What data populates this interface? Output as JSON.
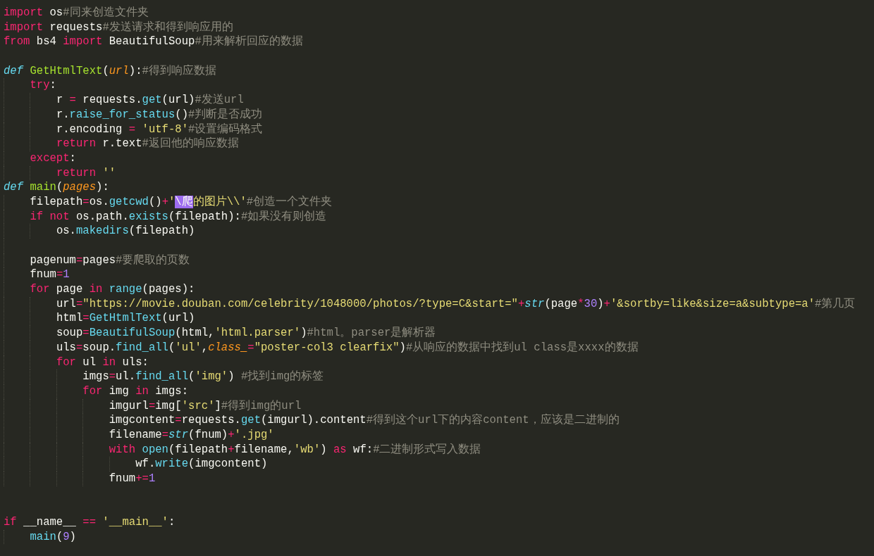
{
  "editor": {
    "lines": [
      {
        "kind": "code",
        "tokens": [
          {
            "kind": "k",
            "text": "import"
          },
          {
            "kind": "x",
            "text": " os"
          },
          {
            "kind": "m",
            "text": "#同来创造文件夹"
          }
        ]
      },
      {
        "kind": "code",
        "tokens": [
          {
            "kind": "k",
            "text": "import"
          },
          {
            "kind": "x",
            "text": " requests"
          },
          {
            "kind": "m",
            "text": "#发送请求和得到响应用的"
          }
        ]
      },
      {
        "kind": "code",
        "tokens": [
          {
            "kind": "k",
            "text": "from"
          },
          {
            "kind": "x",
            "text": " bs4 "
          },
          {
            "kind": "k",
            "text": "import"
          },
          {
            "kind": "x",
            "text": " BeautifulSoup"
          },
          {
            "kind": "m",
            "text": "#用来解析回应的数据"
          }
        ]
      },
      {
        "kind": "blank"
      },
      {
        "kind": "code",
        "tokens": [
          {
            "kind": "t",
            "text": "def"
          },
          {
            "kind": "f",
            "text": " GetHtmlText"
          },
          {
            "kind": "x",
            "text": "("
          },
          {
            "kind": "p",
            "text": "url"
          },
          {
            "kind": "x",
            "text": "):"
          },
          {
            "kind": "m",
            "text": "#得到响应数据"
          }
        ],
        "children": [
          {
            "kind": "code",
            "tokens": [
              {
                "kind": "k",
                "text": "try"
              },
              {
                "kind": "x",
                "text": ":"
              }
            ],
            "children": [
              {
                "kind": "code",
                "tokens": [
                  {
                    "kind": "x",
                    "text": "r "
                  },
                  {
                    "kind": "o",
                    "text": "="
                  },
                  {
                    "kind": "x",
                    "text": " requests."
                  },
                  {
                    "kind": "c",
                    "text": "get"
                  },
                  {
                    "kind": "x",
                    "text": "(url)"
                  },
                  {
                    "kind": "m",
                    "text": "#发送url"
                  }
                ]
              },
              {
                "kind": "code",
                "tokens": [
                  {
                    "kind": "x",
                    "text": "r."
                  },
                  {
                    "kind": "c",
                    "text": "raise_for_status"
                  },
                  {
                    "kind": "x",
                    "text": "()"
                  },
                  {
                    "kind": "m",
                    "text": "#判断是否成功"
                  }
                ]
              },
              {
                "kind": "code",
                "tokens": [
                  {
                    "kind": "x",
                    "text": "r.encoding "
                  },
                  {
                    "kind": "o",
                    "text": "="
                  },
                  {
                    "kind": "s",
                    "text": " 'utf-8'"
                  },
                  {
                    "kind": "m",
                    "text": "#设置编码格式"
                  }
                ]
              },
              {
                "kind": "code",
                "tokens": [
                  {
                    "kind": "k",
                    "text": "return"
                  },
                  {
                    "kind": "x",
                    "text": " r.text"
                  },
                  {
                    "kind": "m",
                    "text": "#返回他的响应数据"
                  }
                ]
              }
            ]
          },
          {
            "kind": "code",
            "tokens": [
              {
                "kind": "k",
                "text": "except"
              },
              {
                "kind": "x",
                "text": ":"
              }
            ],
            "children": [
              {
                "kind": "code",
                "tokens": [
                  {
                    "kind": "k",
                    "text": "return"
                  },
                  {
                    "kind": "s",
                    "text": " ''"
                  }
                ]
              }
            ]
          }
        ]
      },
      {
        "kind": "code",
        "tokens": [
          {
            "kind": "t",
            "text": "def"
          },
          {
            "kind": "f",
            "text": " main"
          },
          {
            "kind": "x",
            "text": "("
          },
          {
            "kind": "p",
            "text": "pages"
          },
          {
            "kind": "x",
            "text": "):"
          }
        ],
        "children": [
          {
            "kind": "code",
            "tokens": [
              {
                "kind": "x",
                "text": "filepath"
              },
              {
                "kind": "o",
                "text": "="
              },
              {
                "kind": "x",
                "text": "os."
              },
              {
                "kind": "c",
                "text": "getcwd"
              },
              {
                "kind": "x",
                "text": "()"
              },
              {
                "kind": "o",
                "text": "+"
              },
              {
                "kind": "s",
                "text": "'"
              },
              {
                "kind": "sel",
                "text": "\\爬"
              },
              {
                "kind": "s",
                "text": "的图片\\\\'"
              },
              {
                "kind": "m",
                "text": "#创造一个文件夹"
              }
            ]
          },
          {
            "kind": "code",
            "tokens": [
              {
                "kind": "k",
                "text": "if"
              },
              {
                "kind": "k",
                "text": " not"
              },
              {
                "kind": "x",
                "text": " os.path."
              },
              {
                "kind": "c",
                "text": "exists"
              },
              {
                "kind": "x",
                "text": "(filepath):"
              },
              {
                "kind": "m",
                "text": "#如果没有则创造"
              }
            ],
            "children": [
              {
                "kind": "code",
                "tokens": [
                  {
                    "kind": "x",
                    "text": "os."
                  },
                  {
                    "kind": "c",
                    "text": "makedirs"
                  },
                  {
                    "kind": "x",
                    "text": "(filepath)"
                  }
                ]
              }
            ]
          },
          {
            "kind": "blank"
          },
          {
            "kind": "code",
            "tokens": [
              {
                "kind": "x",
                "text": "pagenum"
              },
              {
                "kind": "o",
                "text": "="
              },
              {
                "kind": "x",
                "text": "pages"
              },
              {
                "kind": "m",
                "text": "#要爬取的页数"
              }
            ]
          },
          {
            "kind": "code",
            "tokens": [
              {
                "kind": "x",
                "text": "fnum"
              },
              {
                "kind": "o",
                "text": "="
              },
              {
                "kind": "n",
                "text": "1"
              }
            ]
          },
          {
            "kind": "code",
            "tokens": [
              {
                "kind": "k",
                "text": "for"
              },
              {
                "kind": "x",
                "text": " page "
              },
              {
                "kind": "k",
                "text": "in"
              },
              {
                "kind": "c",
                "text": " range"
              },
              {
                "kind": "x",
                "text": "(pages):"
              }
            ],
            "children": [
              {
                "kind": "code",
                "tokens": [
                  {
                    "kind": "x",
                    "text": "url"
                  },
                  {
                    "kind": "o",
                    "text": "="
                  },
                  {
                    "kind": "s",
                    "text": "\"https://movie.douban.com/celebrity/1048000/photos/?type=C&start=\""
                  },
                  {
                    "kind": "o",
                    "text": "+"
                  },
                  {
                    "kind": "t",
                    "text": "str"
                  },
                  {
                    "kind": "x",
                    "text": "(page"
                  },
                  {
                    "kind": "o",
                    "text": "*"
                  },
                  {
                    "kind": "n",
                    "text": "30"
                  },
                  {
                    "kind": "x",
                    "text": ")"
                  },
                  {
                    "kind": "o",
                    "text": "+"
                  },
                  {
                    "kind": "s",
                    "text": "'&sortby=like&size=a&subtype=a'"
                  },
                  {
                    "kind": "m",
                    "text": "#第几页"
                  }
                ]
              },
              {
                "kind": "code",
                "tokens": [
                  {
                    "kind": "x",
                    "text": "html"
                  },
                  {
                    "kind": "o",
                    "text": "="
                  },
                  {
                    "kind": "c",
                    "text": "GetHtmlText"
                  },
                  {
                    "kind": "x",
                    "text": "(url)"
                  }
                ]
              },
              {
                "kind": "code",
                "tokens": [
                  {
                    "kind": "x",
                    "text": "soup"
                  },
                  {
                    "kind": "o",
                    "text": "="
                  },
                  {
                    "kind": "c",
                    "text": "BeautifulSoup"
                  },
                  {
                    "kind": "x",
                    "text": "(html,"
                  },
                  {
                    "kind": "s",
                    "text": "'html.parser'"
                  },
                  {
                    "kind": "x",
                    "text": ")"
                  },
                  {
                    "kind": "m",
                    "text": "#html。parser是解析器"
                  }
                ]
              },
              {
                "kind": "code",
                "tokens": [
                  {
                    "kind": "x",
                    "text": "uls"
                  },
                  {
                    "kind": "o",
                    "text": "="
                  },
                  {
                    "kind": "x",
                    "text": "soup."
                  },
                  {
                    "kind": "c",
                    "text": "find_all"
                  },
                  {
                    "kind": "x",
                    "text": "("
                  },
                  {
                    "kind": "s",
                    "text": "'ul'"
                  },
                  {
                    "kind": "x",
                    "text": ","
                  },
                  {
                    "kind": "p",
                    "text": "class_"
                  },
                  {
                    "kind": "o",
                    "text": "="
                  },
                  {
                    "kind": "s",
                    "text": "\"poster-col3 clearfix\""
                  },
                  {
                    "kind": "x",
                    "text": ")"
                  },
                  {
                    "kind": "m",
                    "text": "#从响应的数据中找到ul class是xxxx的数据"
                  }
                ]
              },
              {
                "kind": "code",
                "tokens": [
                  {
                    "kind": "k",
                    "text": "for"
                  },
                  {
                    "kind": "x",
                    "text": " ul "
                  },
                  {
                    "kind": "k",
                    "text": "in"
                  },
                  {
                    "kind": "x",
                    "text": " uls:"
                  }
                ],
                "children": [
                  {
                    "kind": "code",
                    "tokens": [
                      {
                        "kind": "x",
                        "text": "imgs"
                      },
                      {
                        "kind": "o",
                        "text": "="
                      },
                      {
                        "kind": "x",
                        "text": "ul."
                      },
                      {
                        "kind": "c",
                        "text": "find_all"
                      },
                      {
                        "kind": "x",
                        "text": "("
                      },
                      {
                        "kind": "s",
                        "text": "'img'"
                      },
                      {
                        "kind": "x",
                        "text": ")"
                      },
                      {
                        "kind": "m",
                        "text": " #找到img的标签"
                      }
                    ]
                  },
                  {
                    "kind": "code",
                    "tokens": [
                      {
                        "kind": "k",
                        "text": "for"
                      },
                      {
                        "kind": "x",
                        "text": " img "
                      },
                      {
                        "kind": "k",
                        "text": "in"
                      },
                      {
                        "kind": "x",
                        "text": " imgs:"
                      }
                    ],
                    "children": [
                      {
                        "kind": "code",
                        "tokens": [
                          {
                            "kind": "x",
                            "text": "imgurl"
                          },
                          {
                            "kind": "o",
                            "text": "="
                          },
                          {
                            "kind": "x",
                            "text": "img["
                          },
                          {
                            "kind": "s",
                            "text": "'src'"
                          },
                          {
                            "kind": "x",
                            "text": "]"
                          },
                          {
                            "kind": "m",
                            "text": "#得到img的url"
                          }
                        ]
                      },
                      {
                        "kind": "code",
                        "tokens": [
                          {
                            "kind": "x",
                            "text": "imgcontent"
                          },
                          {
                            "kind": "o",
                            "text": "="
                          },
                          {
                            "kind": "x",
                            "text": "requests."
                          },
                          {
                            "kind": "c",
                            "text": "get"
                          },
                          {
                            "kind": "x",
                            "text": "(imgurl).content"
                          },
                          {
                            "kind": "m",
                            "text": "#得到这个url下的内容content，应该是二进制的"
                          }
                        ]
                      },
                      {
                        "kind": "code",
                        "tokens": [
                          {
                            "kind": "x",
                            "text": "filename"
                          },
                          {
                            "kind": "o",
                            "text": "="
                          },
                          {
                            "kind": "t",
                            "text": "str"
                          },
                          {
                            "kind": "x",
                            "text": "(fnum)"
                          },
                          {
                            "kind": "o",
                            "text": "+"
                          },
                          {
                            "kind": "s",
                            "text": "'.jpg'"
                          }
                        ]
                      },
                      {
                        "kind": "code",
                        "tokens": [
                          {
                            "kind": "k",
                            "text": "with"
                          },
                          {
                            "kind": "c",
                            "text": " open"
                          },
                          {
                            "kind": "x",
                            "text": "(filepath"
                          },
                          {
                            "kind": "o",
                            "text": "+"
                          },
                          {
                            "kind": "x",
                            "text": "filename,"
                          },
                          {
                            "kind": "s",
                            "text": "'wb'"
                          },
                          {
                            "kind": "x",
                            "text": ")"
                          },
                          {
                            "kind": "k",
                            "text": " as"
                          },
                          {
                            "kind": "x",
                            "text": " wf:"
                          },
                          {
                            "kind": "m",
                            "text": "#二进制形式写入数据"
                          }
                        ],
                        "children": [
                          {
                            "kind": "code",
                            "tokens": [
                              {
                                "kind": "x",
                                "text": "wf."
                              },
                              {
                                "kind": "c",
                                "text": "write"
                              },
                              {
                                "kind": "x",
                                "text": "(imgcontent)"
                              }
                            ]
                          }
                        ]
                      },
                      {
                        "kind": "code",
                        "tokens": [
                          {
                            "kind": "x",
                            "text": "fnum"
                          },
                          {
                            "kind": "o",
                            "text": "+="
                          },
                          {
                            "kind": "n",
                            "text": "1"
                          }
                        ]
                      }
                    ]
                  }
                ]
              }
            ]
          }
        ]
      },
      {
        "kind": "blank"
      },
      {
        "kind": "blank"
      },
      {
        "kind": "code",
        "tokens": [
          {
            "kind": "k",
            "text": "if"
          },
          {
            "kind": "x",
            "text": " __name__ "
          },
          {
            "kind": "o",
            "text": "=="
          },
          {
            "kind": "s",
            "text": " '__main__'"
          },
          {
            "kind": "x",
            "text": ":"
          }
        ],
        "children": [
          {
            "kind": "code",
            "tokens": [
              {
                "kind": "c",
                "text": "main"
              },
              {
                "kind": "x",
                "text": "("
              },
              {
                "kind": "n",
                "text": "9"
              },
              {
                "kind": "x",
                "text": ")"
              }
            ]
          }
        ]
      }
    ]
  }
}
